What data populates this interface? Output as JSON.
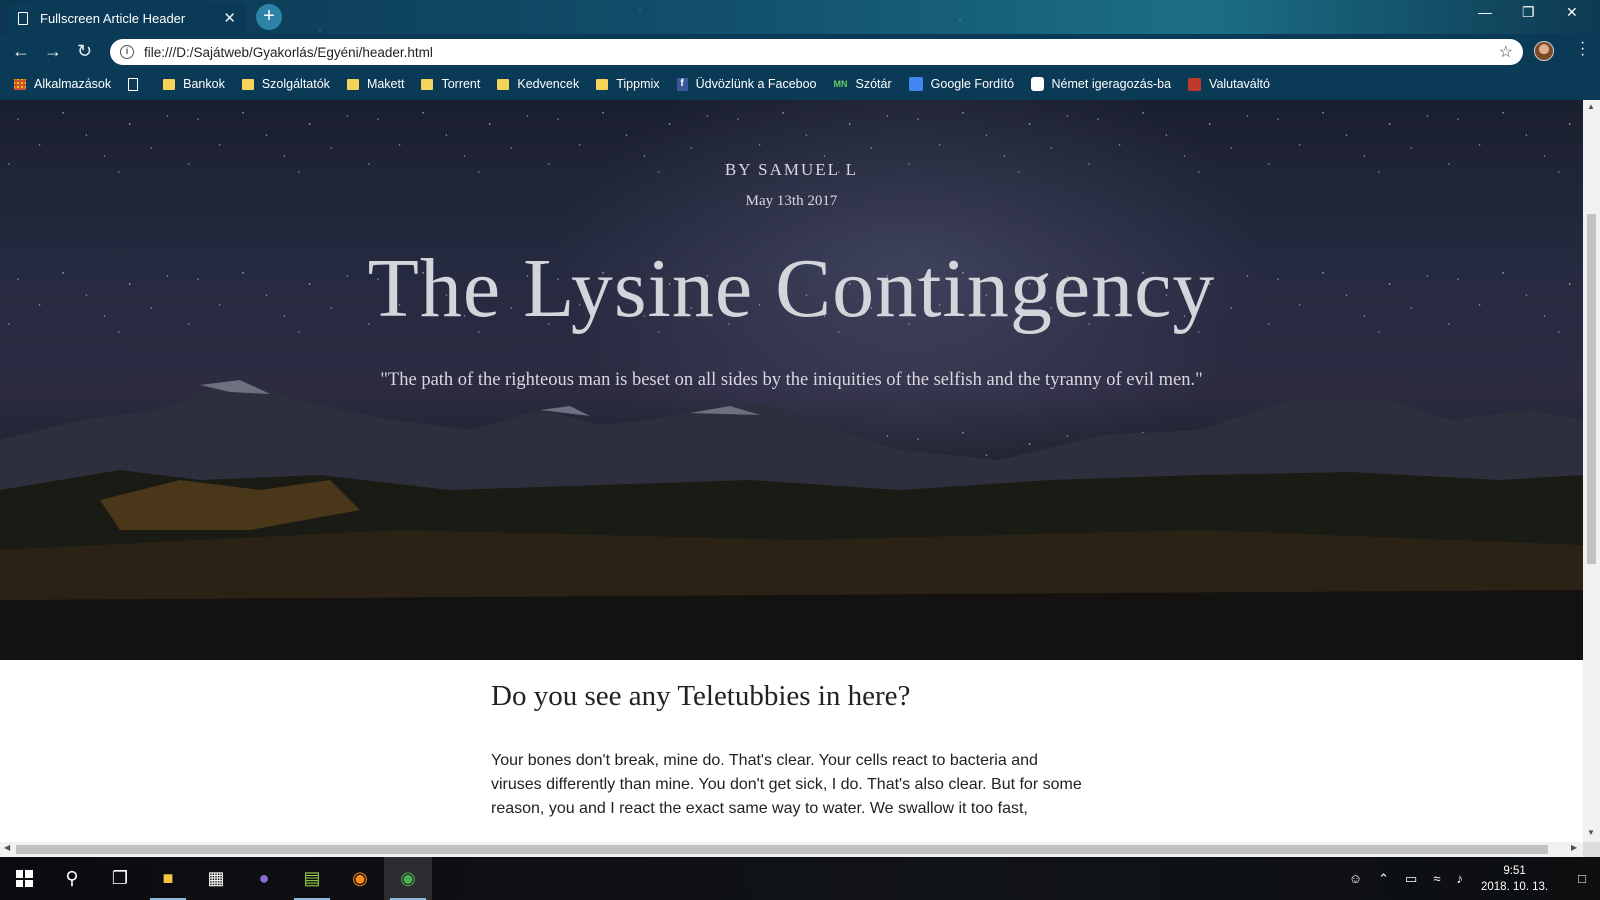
{
  "browser": {
    "tab_title": "Fullscreen Article Header",
    "tab_close": "✕",
    "new_tab": "+",
    "url": "file:///D:/Sajátweb/Gyakorlás/Egyéni/header.html",
    "bookmarks": [
      {
        "label": "Alkalmazások",
        "icon": "apps-icon"
      },
      {
        "label": "",
        "icon": "page-icon"
      },
      {
        "label": "Bankok",
        "icon": "folder-icon"
      },
      {
        "label": "Szolgáltatók",
        "icon": "folder-icon"
      },
      {
        "label": "Makett",
        "icon": "folder-icon"
      },
      {
        "label": "Torrent",
        "icon": "folder-icon"
      },
      {
        "label": "Kedvencek",
        "icon": "folder-icon"
      },
      {
        "label": "Tippmix",
        "icon": "folder-icon"
      },
      {
        "label": "Üdvözlünk a Faceboo",
        "icon": "facebook-icon"
      },
      {
        "label": "Szótár",
        "icon": "dictionary-icon"
      },
      {
        "label": "Google Fordító",
        "icon": "google-translate-icon"
      },
      {
        "label": "Német igeragozás-ba",
        "icon": "german-conjugation-icon"
      },
      {
        "label": "Valutaváltó",
        "icon": "currency-icon"
      }
    ]
  },
  "hero": {
    "byline": "BY SAMUEL L",
    "date": "May 13th 2017",
    "title": "The Lysine Contingency",
    "quote": "\"The path of the righteous man is beset on all sides by the iniquities of the selfish and the tyranny of evil men.\""
  },
  "article": {
    "heading": "Do you see any Teletubbies in here?",
    "paragraph": "Your bones don't break, mine do. That's clear. Your cells react to bacteria and viruses differently than mine. You don't get sick, I do. That's also clear. But for some reason, you and I react the exact same way to water. We swallow it too fast,"
  },
  "taskbar": {
    "time": "9:51",
    "date": "2018. 10. 13."
  },
  "colors": {
    "chrome_bg": "#0b3a56",
    "hero_text": "#d4d4db",
    "body_text": "#222222"
  }
}
